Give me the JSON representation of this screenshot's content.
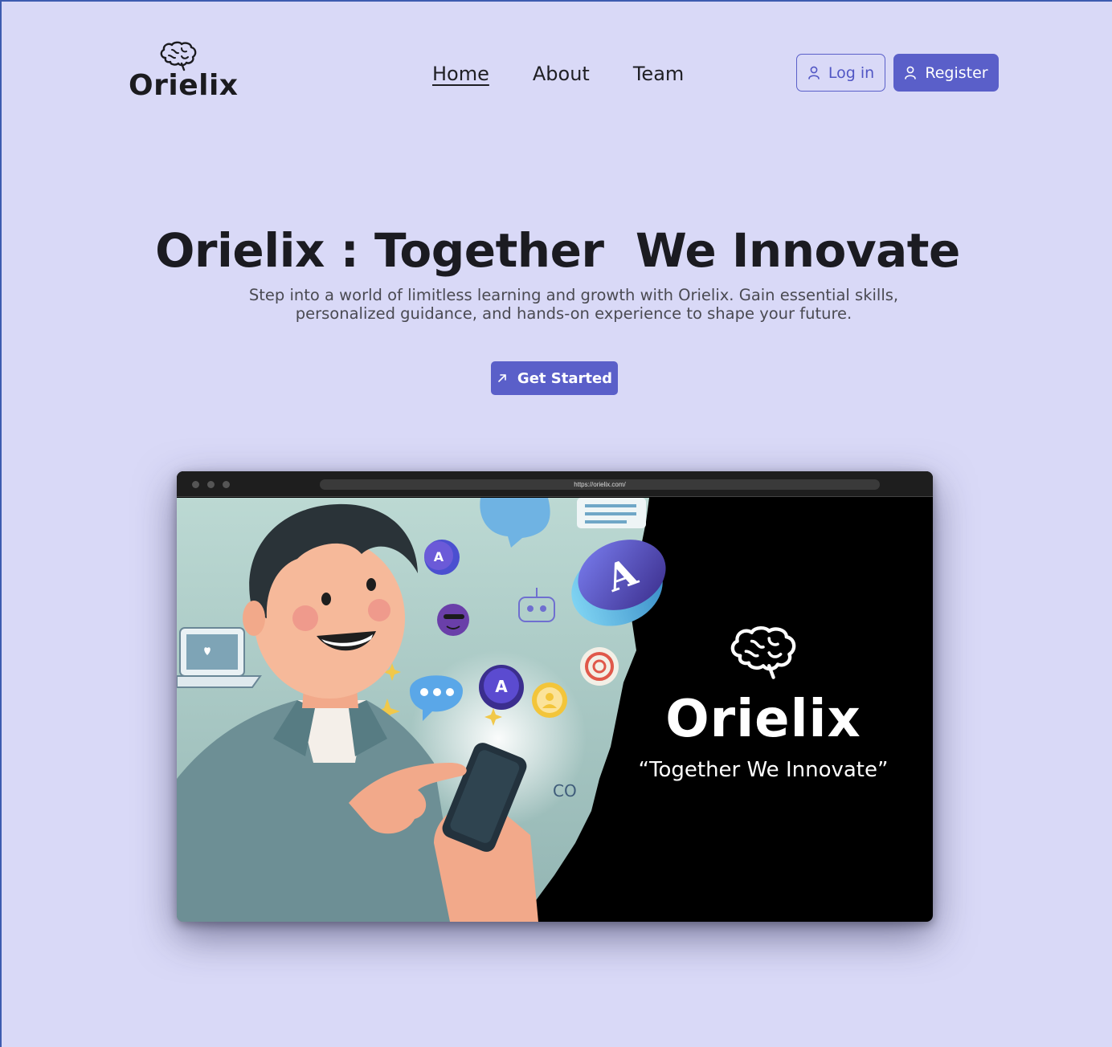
{
  "header": {
    "logo_text": "Orielix",
    "nav": [
      "Home",
      "About",
      "Team"
    ],
    "login_label": "Log in",
    "register_label": "Register"
  },
  "hero": {
    "title": "Orielix : Together  We Innovate",
    "subtitle": "Step into a world of limitless learning and growth with Orielix. Gain essential skills, personalized guidance, and hands-on experience to shape your future.",
    "cta_label": "Get Started"
  },
  "preview": {
    "url": "https://orielix.com/",
    "brand": "Orielix",
    "tagline": "“Together We Innovate”",
    "float_text": "CO"
  },
  "colors": {
    "background": "#d9d9f7",
    "accent": "#5a5fc9"
  }
}
